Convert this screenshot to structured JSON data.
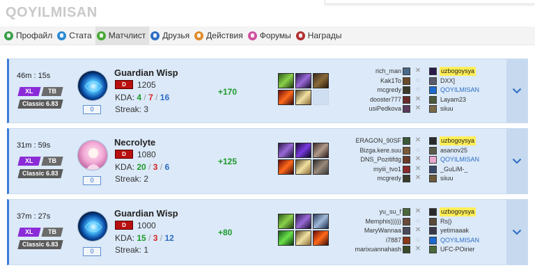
{
  "header": {
    "username": "QOYILMISAN"
  },
  "tabs": [
    {
      "label": "Профайл",
      "icon": "profile-icon",
      "color": "#3aa04a"
    },
    {
      "label": "Стата",
      "icon": "stats-icon",
      "color": "#2c8ad4"
    },
    {
      "label": "Матчлист",
      "icon": "matchlist-icon",
      "color": "#4aa835",
      "active": true
    },
    {
      "label": "Друзья",
      "icon": "friends-icon",
      "color": "#2c6cc4"
    },
    {
      "label": "Действия",
      "icon": "actions-icon",
      "color": "#e08a2a"
    },
    {
      "label": "Форумы",
      "icon": "forums-icon",
      "color": "#d14fa0"
    },
    {
      "label": "Награды",
      "icon": "awards-icon",
      "color": "#b03030"
    }
  ],
  "matches": [
    {
      "duration": "46m : 15s",
      "mode_tags": [
        "XL",
        "TB"
      ],
      "version": "Classic 6.83",
      "hero": "Guardian Wisp",
      "hero_level": "0",
      "rank_badge": "D",
      "rating": "1205",
      "kda_label": "KDA:",
      "kills": "4",
      "deaths": "7",
      "assists": "16",
      "streak_label": "Streak:",
      "streak": "3",
      "mmr_change": "+170",
      "players": [
        {
          "left": "rich_man",
          "right": "uzbogoysya",
          "highlight": true
        },
        {
          "left": "Kak1To",
          "right": "DXX]"
        },
        {
          "left": "mcgredy",
          "right": "QOYILMISAN",
          "me": true
        },
        {
          "left": "dooster777",
          "right": "Layam23"
        },
        {
          "left": "usiPedkova",
          "right": "siiuu"
        }
      ]
    },
    {
      "duration": "31m : 59s",
      "mode_tags": [
        "XL",
        "TB"
      ],
      "version": "Classic 6.83",
      "hero": "Necrolyte",
      "hero_level": "0",
      "rank_badge": "D",
      "rating": "1080",
      "kda_label": "KDA:",
      "kills": "20",
      "deaths": "3",
      "assists": "6",
      "streak_label": "Streak:",
      "streak": "2",
      "mmr_change": "+125",
      "players": [
        {
          "left": "ERAGON_90SF",
          "right": "uzbogoysya",
          "highlight": true
        },
        {
          "left": "Bizga.kere.suu",
          "right": "asanov25"
        },
        {
          "left": "DNS_Pozitifdg",
          "right": "QOYILMISAN",
          "me": true
        },
        {
          "left": "myiii_tvo1",
          "right": "_GuLiM-_"
        },
        {
          "left": "mcgredy",
          "right": "siiuu"
        }
      ]
    },
    {
      "duration": "37m : 27s",
      "mode_tags": [
        "XL",
        "TB"
      ],
      "version": "Classic 6.83",
      "hero": "Guardian Wisp",
      "hero_level": "0",
      "rank_badge": "D",
      "rating": "1000",
      "kda_label": "KDA:",
      "kills": "15",
      "deaths": "3",
      "assists": "12",
      "streak_label": "Streak:",
      "streak": "1",
      "mmr_change": "+80",
      "players": [
        {
          "left": "yu_su_f",
          "right": "uzbogoysya",
          "highlight": true
        },
        {
          "left": "Memphis)))))",
          "right": "Rs|)"
        },
        {
          "left": "MaryWannaa",
          "right": "yetimaaak"
        },
        {
          "left": "i7887",
          "right": "QOYILMISAN",
          "me": true
        },
        {
          "left": "marixuannahash",
          "right": "UFC-POirier"
        }
      ]
    }
  ]
}
